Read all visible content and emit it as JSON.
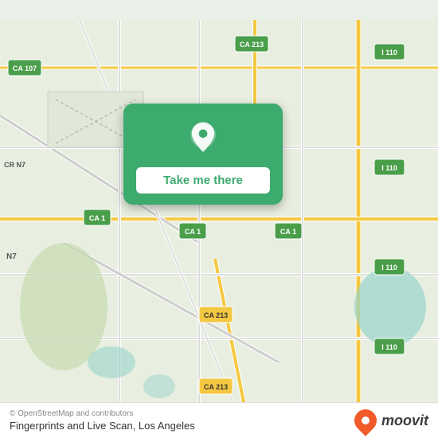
{
  "map": {
    "attribution": "© OpenStreetMap and contributors",
    "place_name": "Fingerprints and Live Scan, Los Angeles",
    "background_color": "#e8efe0"
  },
  "card": {
    "button_label": "Take me there"
  },
  "moovit": {
    "text": "moovit"
  },
  "icons": {
    "location_pin": "location-pin-icon",
    "moovit_logo": "moovit-logo-icon"
  }
}
